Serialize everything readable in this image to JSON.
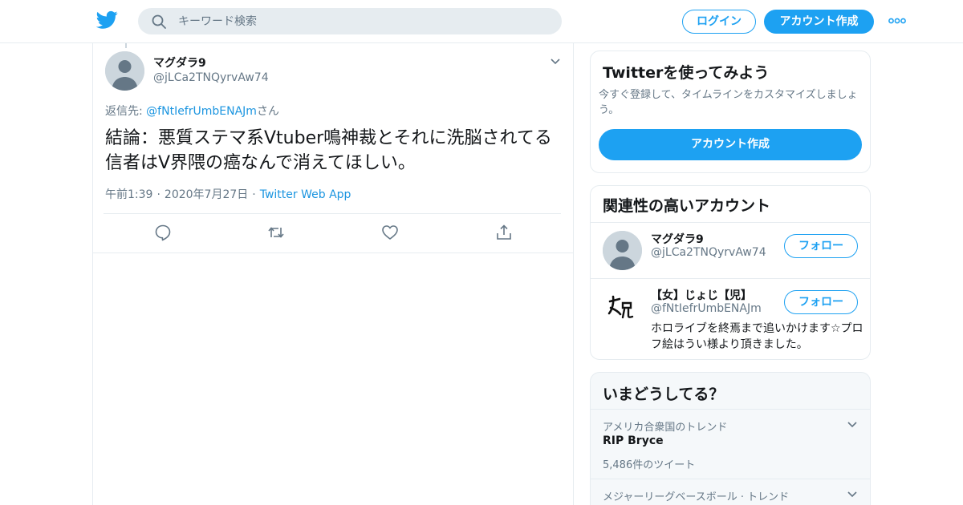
{
  "header": {
    "search_placeholder": "キーワード検索",
    "login_label": "ログイン",
    "signup_label": "アカウント作成",
    "brand_color": "#1da1f2"
  },
  "tweet": {
    "display_name": "マグダラ9",
    "handle": "@jLCa2TNQyrvAw74",
    "reply_prefix": "返信先: ",
    "reply_mention": "@fNtIefrUmbENAJm",
    "reply_suffix": "さん",
    "text": "結論：悪質ステマ系Vtuber鳴神裁とそれに洗脳されてる信者はV界隈の癌なんで消えてほしい。",
    "time": "午前1:39",
    "date": "2020年7月27日",
    "source": "Twitter Web App",
    "dot": "·"
  },
  "sidebar": {
    "signup_card": {
      "title": "Twitterを使ってみよう",
      "description": "今すぐ登録して、タイムラインをカスタマイズしましょう。",
      "button": "アカウント作成"
    },
    "related_accounts": {
      "title": "関連性の高いアカウント",
      "items": [
        {
          "name": "マグダラ9",
          "handle": "@jLCa2TNQyrvAw74",
          "follow": "フォロー",
          "bio": ""
        },
        {
          "name": "【女】じょじ【児】",
          "handle": "@fNtIefrUmbENAJm",
          "follow": "フォロー",
          "bio": "ホロライブを終焉まで追いかけます☆プロフ絵はうい様より頂きました。"
        }
      ]
    },
    "trends": {
      "title": "いまどうしてる？",
      "items": [
        {
          "context": "アメリカ合衆国のトレンド",
          "name": "RIP Bryce",
          "count": "5,486件のツイート"
        },
        {
          "context": "メジャーリーグベースボール · トレンド",
          "name": "",
          "count": ""
        }
      ]
    }
  }
}
